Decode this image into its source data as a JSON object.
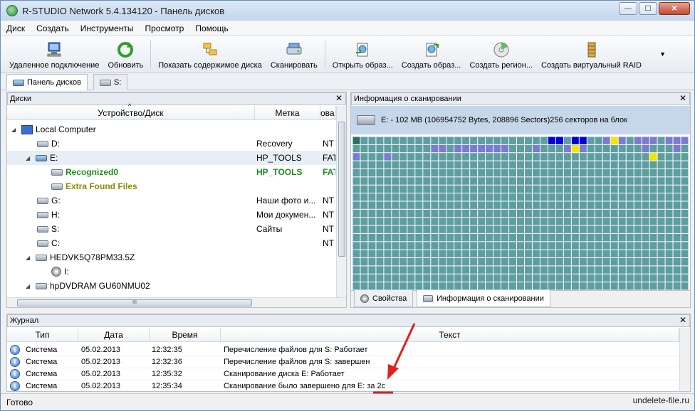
{
  "window": {
    "title": "R-STUDIO Network 5.4.134120 - Панель дисков"
  },
  "window_controls": {
    "minimize": "—",
    "maximize": "☐",
    "close": "✕"
  },
  "menu": [
    "Диск",
    "Создать",
    "Инструменты",
    "Просмотр",
    "Помощь"
  ],
  "toolbar": {
    "buttons": [
      {
        "label": "Удаленное подключение",
        "icon": "computer-connect-icon"
      },
      {
        "label": "Обновить",
        "icon": "refresh-icon"
      },
      {
        "label": "Показать содержимое диска",
        "icon": "folder-tree-icon"
      },
      {
        "label": "Сканировать",
        "icon": "scan-icon"
      },
      {
        "label": "Открыть образ...",
        "icon": "open-image-icon"
      },
      {
        "label": "Создать образ...",
        "icon": "create-image-icon"
      },
      {
        "label": "Создать регион...",
        "icon": "create-region-icon"
      },
      {
        "label": "Создать виртуальный RAID",
        "icon": "raid-icon"
      }
    ],
    "more": "▼"
  },
  "doc_tabs": [
    {
      "label": "Панель дисков"
    },
    {
      "label": "S:"
    }
  ],
  "disks_pane": {
    "title": "Диски",
    "close": "✕",
    "columns": [
      "Устройство/Диск",
      "Метка",
      "ова"
    ],
    "sort_glyph": "^",
    "rows": [
      {
        "name": "Local Computer",
        "label": "",
        "fs": "",
        "expander": "◢",
        "icon": "computer-icon",
        "style": "normal"
      },
      {
        "name": "D:",
        "label": "Recovery",
        "fs": "NT",
        "expander": "",
        "icon": "hdd-icon",
        "style": "normal"
      },
      {
        "name": "E:",
        "label": "HP_TOOLS",
        "fs": "FAT",
        "expander": "◢",
        "icon": "hdd-icon",
        "style": "selected"
      },
      {
        "name": "Recognized0",
        "label": "HP_TOOLS",
        "fs": "FAT",
        "expander": "",
        "icon": "hdd-icon",
        "style": "green"
      },
      {
        "name": "Extra Found Files",
        "label": "",
        "fs": "",
        "expander": "",
        "icon": "hdd-icon",
        "style": "olive"
      },
      {
        "name": "G:",
        "label": "Наши фото и...",
        "fs": "NT",
        "expander": "",
        "icon": "hdd-icon",
        "style": "normal"
      },
      {
        "name": "H:",
        "label": "Мои докумен...",
        "fs": "NT",
        "expander": "",
        "icon": "hdd-icon",
        "style": "normal"
      },
      {
        "name": "S:",
        "label": "Сайты",
        "fs": "NT",
        "expander": "",
        "icon": "hdd-icon",
        "style": "normal"
      },
      {
        "name": "C:",
        "label": "",
        "fs": "NT",
        "expander": "",
        "icon": "hdd-icon",
        "style": "normal"
      },
      {
        "name": "HEDVK5Q78PM33.5Z",
        "label": "",
        "fs": "",
        "expander": "◢",
        "icon": "hdd-icon",
        "style": "normal"
      },
      {
        "name": "I:",
        "label": "",
        "fs": "",
        "expander": "",
        "icon": "cd-icon",
        "style": "normal"
      },
      {
        "name": "hpDVDRAM GU60NMU02",
        "label": "",
        "fs": "",
        "expander": "◢",
        "icon": "hdd-icon",
        "style": "normal"
      }
    ],
    "hscroll_grip": "III"
  },
  "scan_pane": {
    "title": "Информация о сканировании",
    "close": "✕",
    "disk_info": "E: - 102 MB (106954752 Bytes, 208896 Sectors)256 секторов на блок",
    "legend_colors": {
      "empty": "#5f9ea0",
      "scanned": "#7b7bd1",
      "found": "#0000d8",
      "partial": "#f2e500",
      "dark": "#2f6f60"
    },
    "tabs": [
      {
        "label": "Свойства"
      },
      {
        "label": "Информация о сканировании"
      }
    ]
  },
  "log_pane": {
    "title": "Журнал",
    "close": "✕",
    "columns": [
      "Тип",
      "Дата",
      "Время",
      "Текст"
    ],
    "rows": [
      {
        "type": "Система",
        "date": "05.02.2013",
        "time": "12:32:35",
        "text": "Перечисление файлов для S: Работает"
      },
      {
        "type": "Система",
        "date": "05.02.2013",
        "time": "12:32:36",
        "text": "Перечисление файлов для S: завершен"
      },
      {
        "type": "Система",
        "date": "05.02.2013",
        "time": "12:35:32",
        "text": "Сканирование диска E: Работает"
      },
      {
        "type": "Система",
        "date": "05.02.2013",
        "time": "12:35:34",
        "text": "Сканирование было завершено для E: за 2с"
      }
    ]
  },
  "status": {
    "text": "Готово"
  },
  "watermark": "undelete-file.ru"
}
